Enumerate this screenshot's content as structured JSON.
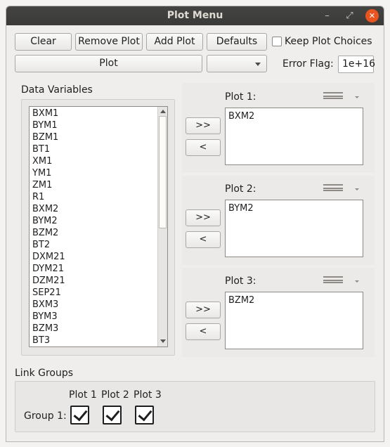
{
  "window": {
    "title": "Plot Menu"
  },
  "toolbar": {
    "clear_label": "Clear",
    "remove_plot_label": "Remove Plot",
    "add_plot_label": "Add Plot",
    "defaults_label": "Defaults",
    "keep_plot_choices_label": "Keep Plot Choices",
    "keep_plot_choices_checked": false,
    "plot_label": "Plot",
    "plot_type_selected": "",
    "error_flag_label": "Error Flag:",
    "error_flag_value": "1e+16"
  },
  "data_variables": {
    "label": "Data Variables",
    "items": [
      "BXM1",
      "BYM1",
      "BZM1",
      "BT1",
      "XM1",
      "YM1",
      "ZM1",
      "R1",
      "BXM2",
      "BYM2",
      "BZM2",
      "BT2",
      "DXM21",
      "DYM21",
      "DZM21",
      "SEP21",
      "BXM3",
      "BYM3",
      "BZM3",
      "BT3"
    ]
  },
  "plots": [
    {
      "label": "Plot 1:",
      "add_label": ">>",
      "remove_label": "<",
      "items": [
        "BXM2"
      ]
    },
    {
      "label": "Plot 2:",
      "add_label": ">>",
      "remove_label": "<",
      "items": [
        "BYM2"
      ]
    },
    {
      "label": "Plot 3:",
      "add_label": ">>",
      "remove_label": "<",
      "items": [
        "BZM2"
      ]
    }
  ],
  "link_groups": {
    "label": "Link Groups",
    "columns": [
      "Plot 1",
      "Plot 2",
      "Plot 3"
    ],
    "rows": [
      {
        "label": "Group 1:",
        "checked": [
          true,
          true,
          true
        ]
      }
    ]
  },
  "colors": {
    "titlebar": "#3c3c3b",
    "close_button": "#e95420",
    "window_bg": "#efeeed"
  }
}
